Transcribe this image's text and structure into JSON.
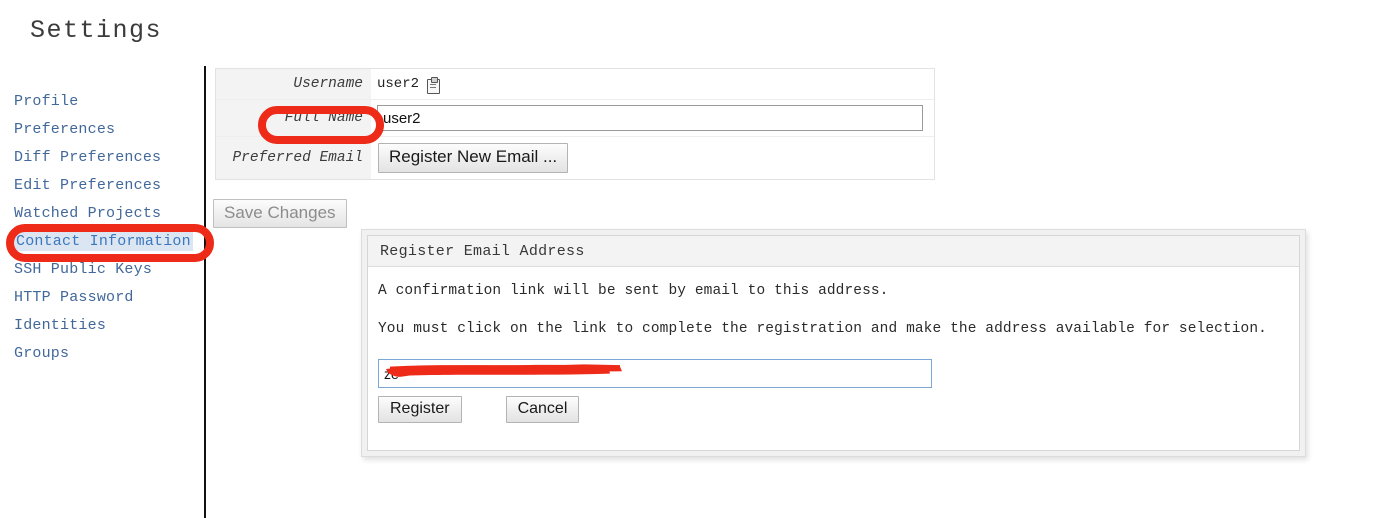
{
  "page": {
    "title": "Settings"
  },
  "sidebar": {
    "items": [
      {
        "label": "Profile",
        "selected": false
      },
      {
        "label": "Preferences",
        "selected": false
      },
      {
        "label": "Diff Preferences",
        "selected": false
      },
      {
        "label": "Edit Preferences",
        "selected": false
      },
      {
        "label": "Watched Projects",
        "selected": false
      },
      {
        "label": "Contact Information",
        "selected": true
      },
      {
        "label": "SSH Public Keys",
        "selected": false
      },
      {
        "label": "HTTP Password",
        "selected": false
      },
      {
        "label": "Identities",
        "selected": false
      },
      {
        "label": "Groups",
        "selected": false
      }
    ]
  },
  "form": {
    "username_label": "Username",
    "username_value": "user2",
    "copy_icon": "clipboard-icon",
    "fullname_label": "Full Name",
    "fullname_value": "user2",
    "preferred_email_label": "Preferred Email",
    "register_new_email_label": "Register New Email ...",
    "save_changes_label": "Save Changes"
  },
  "dialog": {
    "title": "Register Email Address",
    "paragraph_1": "A confirmation link will be sent by email to this address.",
    "paragraph_2": "You must click on the link to complete the registration and make the address available for selection.",
    "email_value": "ze",
    "email_redacted": true,
    "register_label": "Register",
    "cancel_label": "Cancel"
  },
  "annotations": {
    "color": "#ee2a19",
    "highlighted": [
      "Full Name",
      "Contact Information"
    ],
    "redaction_color": "#ee2a19"
  },
  "colors": {
    "link": "#42689a",
    "selection_highlight": "#dbe6f2",
    "label_background": "#f3f3f3",
    "annotation_red": "#ee2a19"
  }
}
